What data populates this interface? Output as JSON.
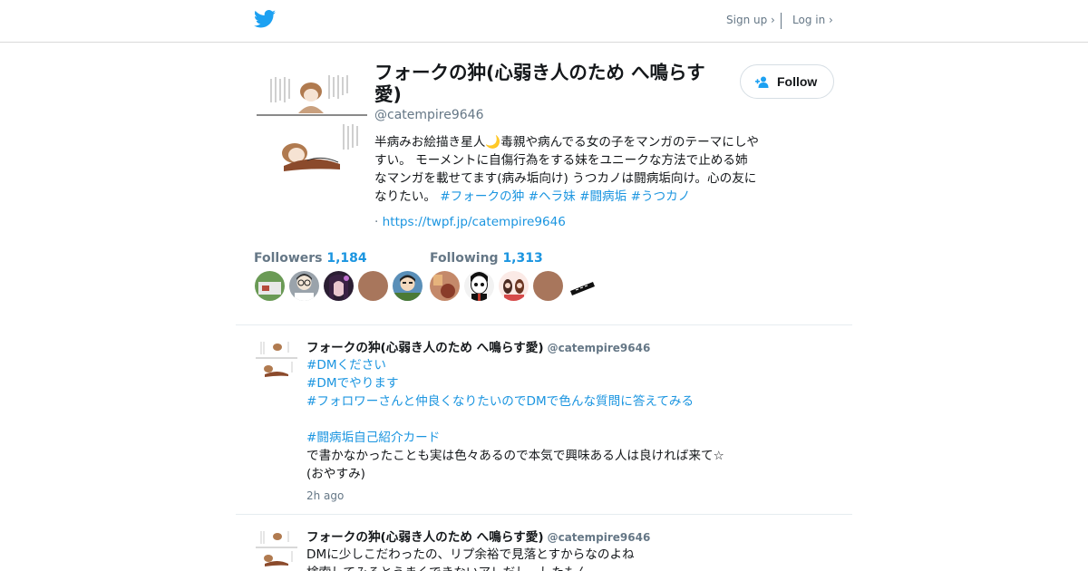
{
  "header": {
    "logo_icon": "twitter-bird-icon",
    "signup_label": "Sign up ›",
    "login_label": "Log in ›"
  },
  "profile": {
    "name": "フォークの狆(心弱き人のため へ鳴らす愛)",
    "handle": "@catempire9646",
    "follow_label": "Follow",
    "bio": {
      "text": "半病みお絵描き星人🌙毒親や病んでる女の子をマンガのテーマにしやすい。 モーメントに自傷行為をする妹をユニークな方法で止める姉なマンガを載せてます(病み垢向け) うつカノは闘病垢向け。心の友になりたい。 ",
      "hashtags": [
        "#フォークの狆",
        "#ヘラ妹",
        "#闘病垢",
        "#うつカノ"
      ]
    },
    "url_prefix": "·",
    "url": "https://twpf.jp/catempire9646"
  },
  "stats": {
    "followers_label": "Followers",
    "followers_count": "1,184",
    "following_label": "Following",
    "following_count": "1,313"
  },
  "colors": {
    "accent": "#1b95e0",
    "muted": "#657786",
    "text": "#14171a",
    "border": "#e6ecf0"
  },
  "tweets": [
    {
      "name": "フォークの狆(心弱き人のため へ鳴らす愛)",
      "handle": "@catempire9646",
      "hashtags": [
        "#DMください",
        "#DMでやります",
        "#フォロワーさんと仲良くなりたいのでDMで色んな質問に答えてみる",
        "#闘病垢自己紹介カード"
      ],
      "line1": "で書かなかったことも実は色々あるので本気で興味ある人は良ければ来て☆",
      "line2": "(おやすみ)",
      "time": "2h ago"
    },
    {
      "name": "フォークの狆(心弱き人のため へ鳴らす愛)",
      "handle": "@catempire9646",
      "line1": "DMに少しこだわったの、リプ余裕で見落とすからなのよね",
      "line2": "検索してみるとうまくできないアレだし...したもん"
    }
  ]
}
